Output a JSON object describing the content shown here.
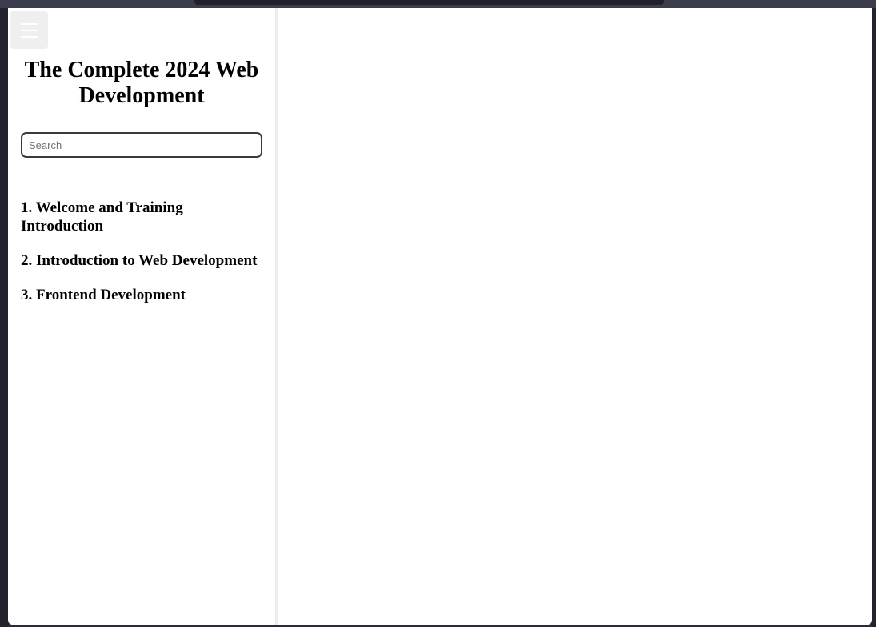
{
  "sidebar": {
    "title": "The Complete 2024 Web Development",
    "search": {
      "placeholder": "Search",
      "value": ""
    },
    "chapters": [
      {
        "label": "1. Welcome and Training Introduction"
      },
      {
        "label": "2. Introduction to Web Development"
      },
      {
        "label": "3. Frontend Development"
      }
    ],
    "menu_icon": "hamburger-menu-icon"
  },
  "colors": {
    "window_background": "#ffffff",
    "frame_background": "#2a2b37",
    "divider": "#ededed",
    "menu_button_background": "#efefef"
  }
}
